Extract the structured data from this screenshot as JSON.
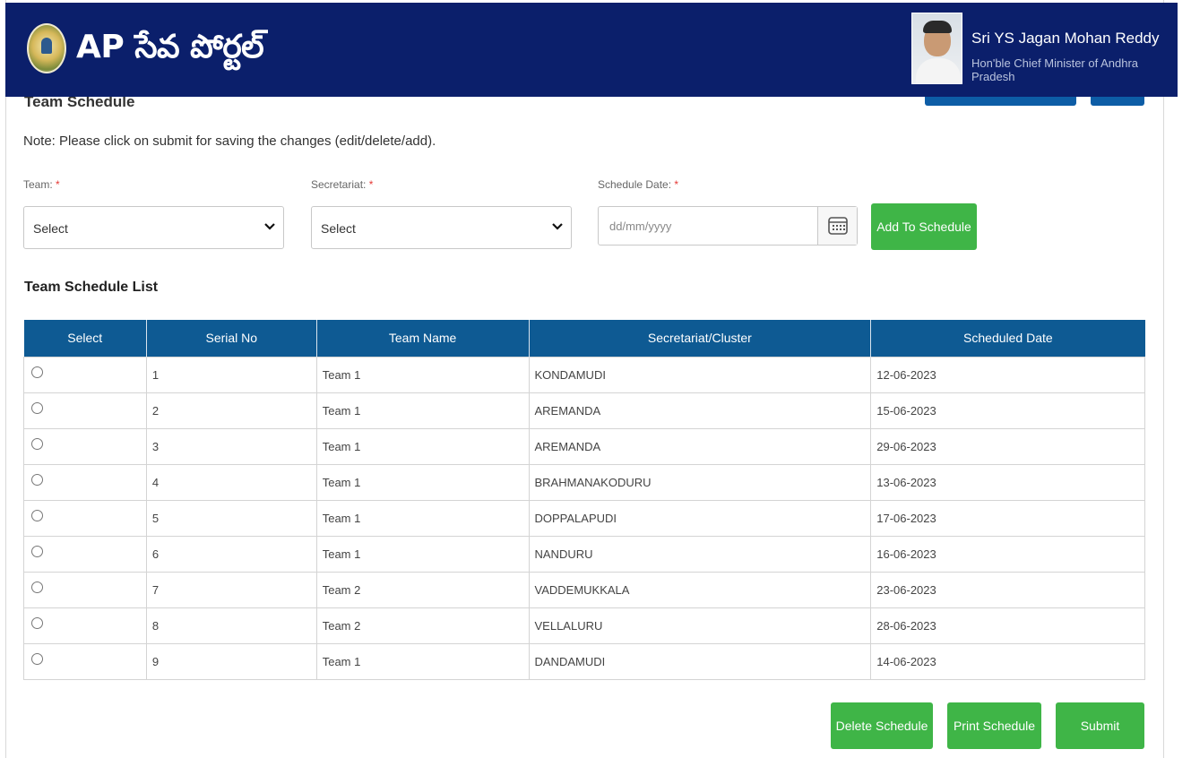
{
  "header": {
    "brand": "AP సేవ పోర్టల్",
    "cm_name": "Sri YS Jagan Mohan Reddy",
    "cm_title": "Hon'ble Chief Minister of Andhra Pradesh"
  },
  "page": {
    "title": "Team Schedule",
    "note": "Note: Please click on submit for saving the changes (edit/delete/add)."
  },
  "form": {
    "team_label": "Team:",
    "team_value": "Select",
    "secretariat_label": "Secretariat:",
    "secretariat_value": "Select",
    "date_label": "Schedule Date:",
    "date_placeholder": "dd/mm/yyyy",
    "required_mark": "*",
    "add_button": "Add To Schedule"
  },
  "list": {
    "title": "Team Schedule List",
    "columns": [
      "Select",
      "Serial No",
      "Team Name",
      "Secretariat/Cluster",
      "Scheduled Date"
    ],
    "rows": [
      {
        "serial": "1",
        "team": "Team 1",
        "cluster": "KONDAMUDI",
        "date": "12-06-2023"
      },
      {
        "serial": "2",
        "team": "Team 1",
        "cluster": "AREMANDA",
        "date": "15-06-2023"
      },
      {
        "serial": "3",
        "team": "Team 1",
        "cluster": "AREMANDA",
        "date": "29-06-2023"
      },
      {
        "serial": "4",
        "team": "Team 1",
        "cluster": "BRAHMANAKODURU",
        "date": "13-06-2023"
      },
      {
        "serial": "5",
        "team": "Team 1",
        "cluster": "DOPPALAPUDI",
        "date": "17-06-2023"
      },
      {
        "serial": "6",
        "team": "Team 1",
        "cluster": "NANDURU",
        "date": "16-06-2023"
      },
      {
        "serial": "7",
        "team": "Team 2",
        "cluster": "VADDEMUKKALA",
        "date": "23-06-2023"
      },
      {
        "serial": "8",
        "team": "Team 2",
        "cluster": "VELLALURU",
        "date": "28-06-2023"
      },
      {
        "serial": "9",
        "team": "Team 1",
        "cluster": "DANDAMUDI",
        "date": "14-06-2023"
      }
    ]
  },
  "actions": {
    "delete": "Delete Schedule",
    "print": "Print Schedule",
    "submit": "Submit"
  },
  "colors": {
    "header_bg": "#0b1f6b",
    "table_header_bg": "#0e5a93",
    "button_green": "#3fb547",
    "required_red": "#e53935"
  },
  "icons": {
    "select": "chevron-down-icon",
    "date": "calendar-icon",
    "logo": "state-emblem-icon"
  }
}
